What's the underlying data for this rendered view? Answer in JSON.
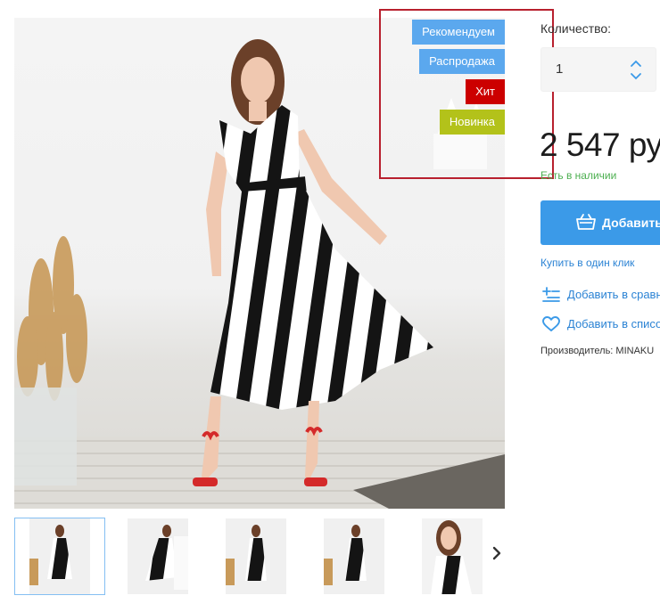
{
  "badges": {
    "recommend": "Рекомендуем",
    "sale": "Распродажа",
    "hit": "Хит",
    "new": "Новинка"
  },
  "quantity": {
    "label": "Количество:",
    "value": "1"
  },
  "price": "2 547 ру",
  "stock": "Есть в наличии",
  "add_button": "Добавить",
  "one_click": "Купить в один клик",
  "compare": "Добавить в сравн",
  "wishlist": "Добавить в списо",
  "manufacturer": "Производитель: MINAKU",
  "colors": {
    "accent": "#3b9ae8",
    "link": "#2b83d4",
    "stock": "#4caf50",
    "badge_blue": "#5ba8ee",
    "badge_red": "#cc0000",
    "badge_green": "#b3c21a",
    "highlight": "#b8202e"
  },
  "icons": {
    "qty_up": "chevron-up-icon",
    "qty_down": "chevron-down-icon",
    "cart": "basket-icon",
    "compare": "compare-list-icon",
    "wishlist": "heart-icon",
    "gallery_next": "chevron-right-icon"
  }
}
